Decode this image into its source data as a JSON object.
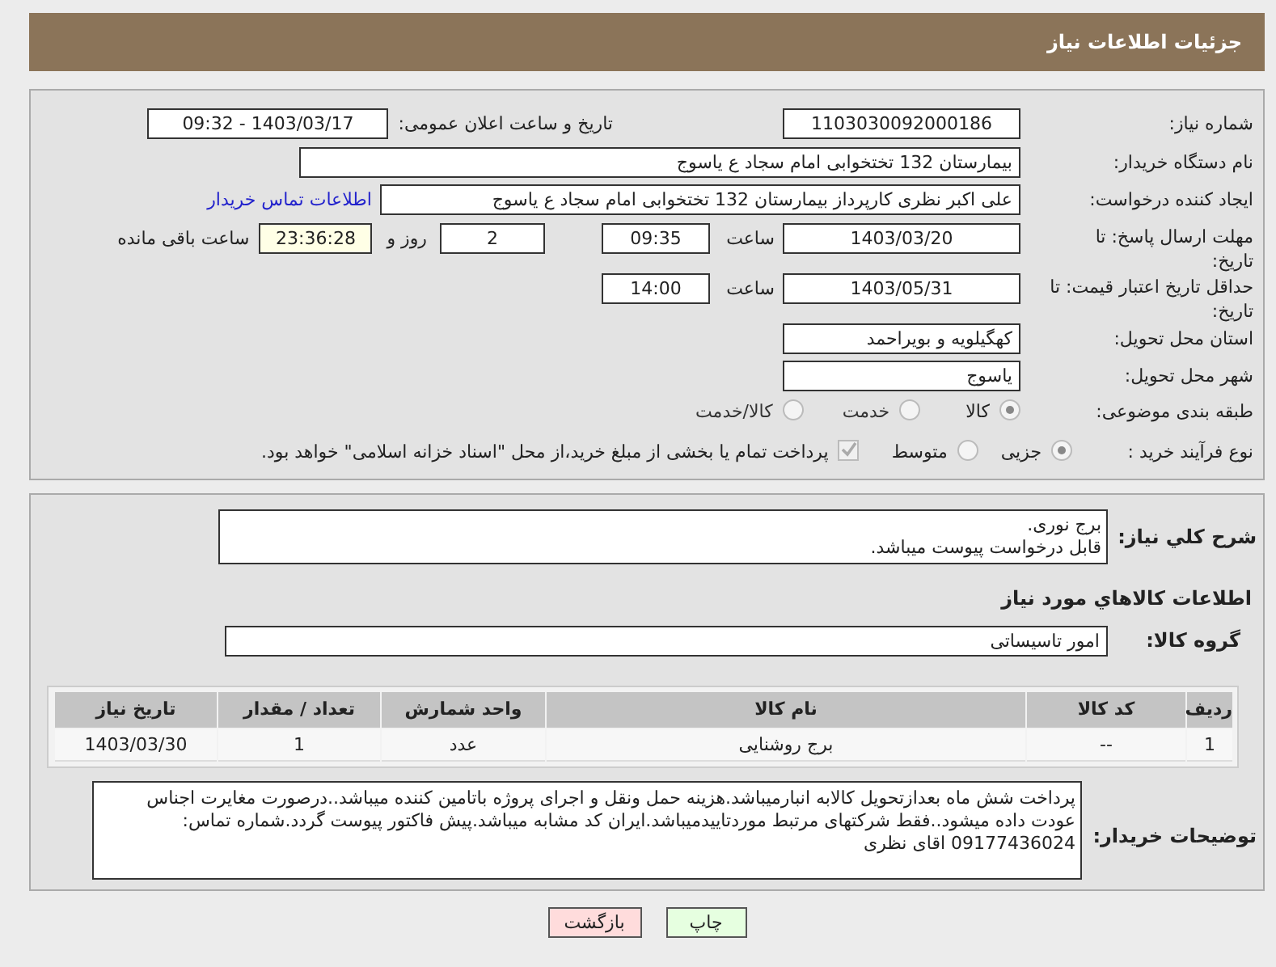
{
  "header": {
    "title": "جزئیات اطلاعات نیاز"
  },
  "need_number": {
    "label": "شماره نیاز:",
    "value": "1103030092000186"
  },
  "announce": {
    "label": "تاریخ و ساعت اعلان عمومی:",
    "value": "1403/03/17 - 09:32"
  },
  "buyer": {
    "label": "نام دستگاه خریدار:",
    "value": "بیمارستان 132 تختخوابی امام سجاد  ع  یاسوج"
  },
  "requester": {
    "label": "ایجاد کننده درخواست:",
    "value": "علی اکبر نظری  کارپرداز بیمارستان 132 تختخوابی امام سجاد  ع  یاسوج",
    "link": "اطلاعات تماس خریدار"
  },
  "deadline": {
    "label": "مهلت ارسال پاسخ: تا تاریخ:",
    "date": "1403/03/20",
    "time_label": "ساعت",
    "time": "09:35",
    "days": "2",
    "days_label": "روز و",
    "remaining": "23:36:28",
    "remaining_label": "ساعت باقی مانده"
  },
  "validity": {
    "label": "حداقل تاریخ اعتبار قیمت: تا تاریخ:",
    "date": "1403/05/31",
    "time_label": "ساعت",
    "time": "14:00"
  },
  "province": {
    "label": "استان محل تحویل:",
    "value": "کهگیلویه و بویراحمد"
  },
  "city": {
    "label": "شهر محل تحویل:",
    "value": "یاسوج"
  },
  "category": {
    "label": "طبقه بندی موضوعی:",
    "options": [
      {
        "label": "کالا",
        "selected": true
      },
      {
        "label": "خدمت",
        "selected": false
      },
      {
        "label": "کالا/خدمت",
        "selected": false
      }
    ]
  },
  "process": {
    "label": "نوع فرآیند خرید :",
    "options": [
      {
        "label": "جزیی",
        "selected": true
      },
      {
        "label": "متوسط",
        "selected": false
      }
    ],
    "payment": {
      "checked": true,
      "text": "پرداخت تمام یا بخشی از مبلغ خرید،از محل \"اسناد خزانه اسلامی\" خواهد بود."
    }
  },
  "description": {
    "label": "شرح کلي نياز:",
    "lines": [
      "برج نوری.",
      "قابل درخواست پیوست میباشد."
    ]
  },
  "goods_title": "اطلاعات کالاهاي مورد نياز",
  "goods_group": {
    "label": "گروه کالا:",
    "value": "امور تاسیساتی"
  },
  "table": {
    "columns": [
      "ردیف",
      "کد کالا",
      "نام کالا",
      "واحد شمارش",
      "تعداد / مقدار",
      "تاریخ نیاز"
    ],
    "rows": [
      [
        "1",
        "--",
        "برج روشنایی",
        "عدد",
        "1",
        "1403/03/30"
      ]
    ]
  },
  "buyer_notes": {
    "label": "توضیحات خریدار:",
    "text": "پرداخت شش ماه بعدازتحویل کالابه انبارمیباشد.هزینه حمل ونقل و اجرای پروژه باتامین کننده میباشد..درصورت مغایرت اجناس عودت داده میشود..فقط شرکتهای مرتبط موردتاییدمیباشد.ایران کد مشابه میباشد.پیش فاکتور پیوست گردد.شماره تماس: 09177436024  اقای نظری"
  },
  "buttons": [
    {
      "label": "چاپ",
      "kind": "print"
    },
    {
      "label": "بازگشت",
      "kind": "back"
    }
  ]
}
